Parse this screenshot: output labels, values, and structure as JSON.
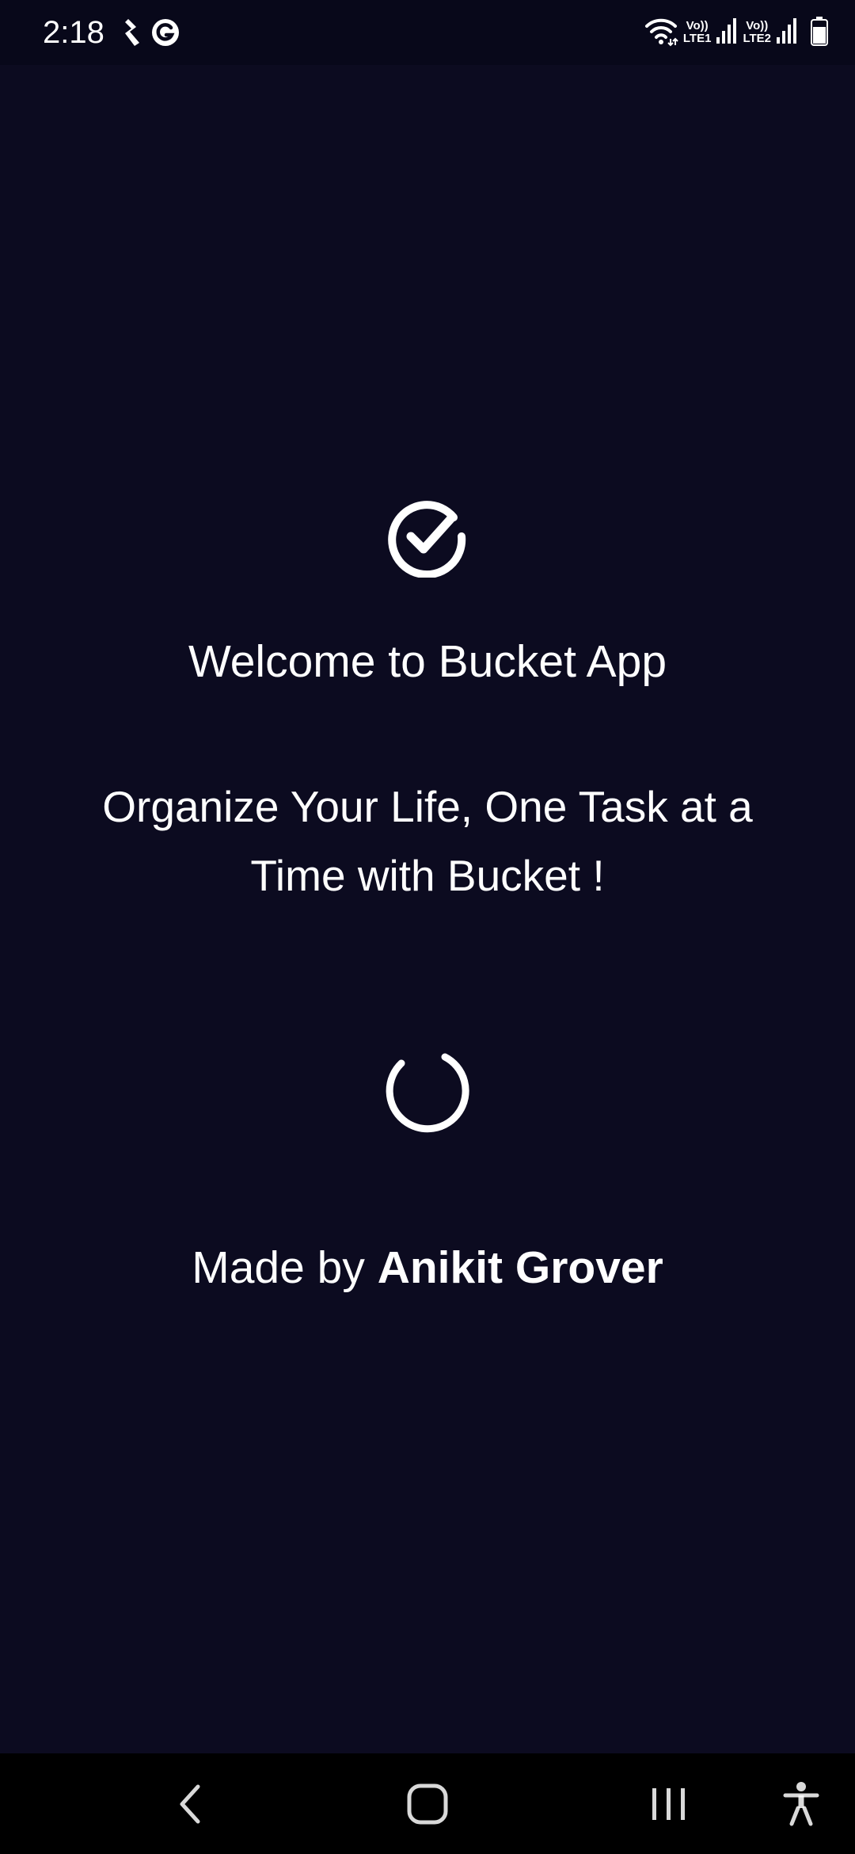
{
  "status_bar": {
    "time": "2:18",
    "left_icons": [
      "app-notification-icon",
      "grammarly-icon"
    ],
    "sim1_top": "Vo))",
    "sim1_bottom": "LTE1",
    "sim2_top": "Vo))",
    "sim2_bottom": "LTE2",
    "right_icons": [
      "wifi-icon",
      "signal-icon",
      "signal-icon",
      "battery-icon"
    ]
  },
  "splash": {
    "logo_icon": "check-circle-icon",
    "welcome_text": "Welcome to Bucket App",
    "tagline": "Organize Your Life, One Task at a Time with Bucket !",
    "loading_icon": "spinner-icon",
    "credit_prefix": "Made by",
    "credit_name": "Anikit Grover"
  },
  "nav_bar": {
    "buttons": [
      "back",
      "home",
      "recents",
      "accessibility"
    ]
  },
  "colors": {
    "background": "#0c0b20",
    "status_bar": "#08081a",
    "nav_bar": "#000000",
    "foreground": "#ffffff"
  }
}
